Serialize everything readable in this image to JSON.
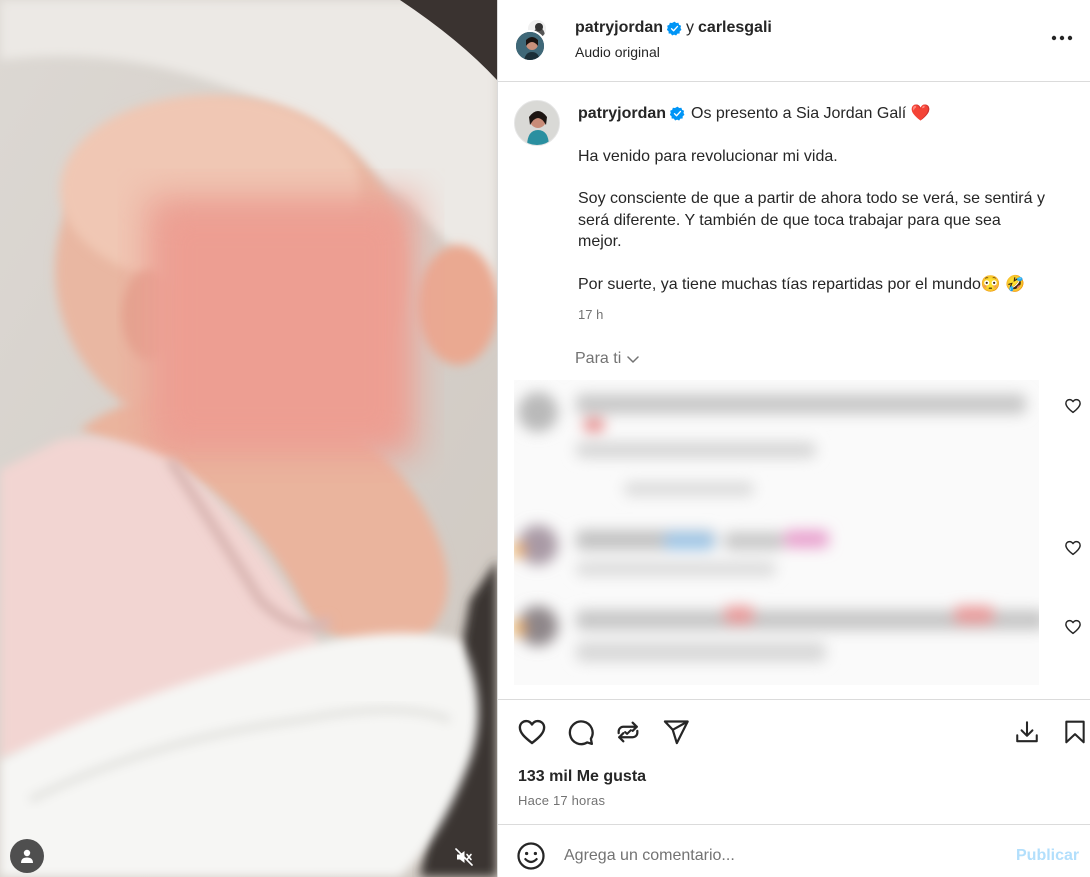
{
  "post": {
    "author": "patryjordan",
    "connector": "y",
    "coauthor": "carlesgali",
    "audio": "Audio original",
    "caption": {
      "username": "patryjordan",
      "title": "Os presento a Sia Jordan Galí",
      "title_emoji": "❤️",
      "paragraph1": "Ha venido para revolucionar mi vida.",
      "paragraph2_line1": "Soy consciente de que a partir de ahora todo se verá, se sentirá y",
      "paragraph2_line2": "será diferente. Y también de que toca trabajar para que sea",
      "paragraph2_line3": "mejor.",
      "paragraph3": "Por suerte, ya tiene muchas tías repartidas por el mundo",
      "paragraph3_emojis": "😳 🤣",
      "time": "17 h"
    },
    "for_you": "Para ti",
    "likes": "133 mil Me gusta",
    "posted": "Hace 17 horas"
  },
  "comment_box": {
    "placeholder": "Agrega un comentario...",
    "publish": "Publicar"
  },
  "colors": {
    "verified": "#0095f6",
    "publish_disabled": "#b2dffc",
    "secondary_text": "#737373",
    "divider": "#dbdbdb"
  },
  "icons": [
    "verified-badge-icon",
    "more-options-icon",
    "chevron-down-icon",
    "heart-icon",
    "comment-icon",
    "repost-icon",
    "share-icon",
    "save-icon",
    "bookmark-icon",
    "emoji-icon",
    "user-tag-icon",
    "mute-icon"
  ]
}
